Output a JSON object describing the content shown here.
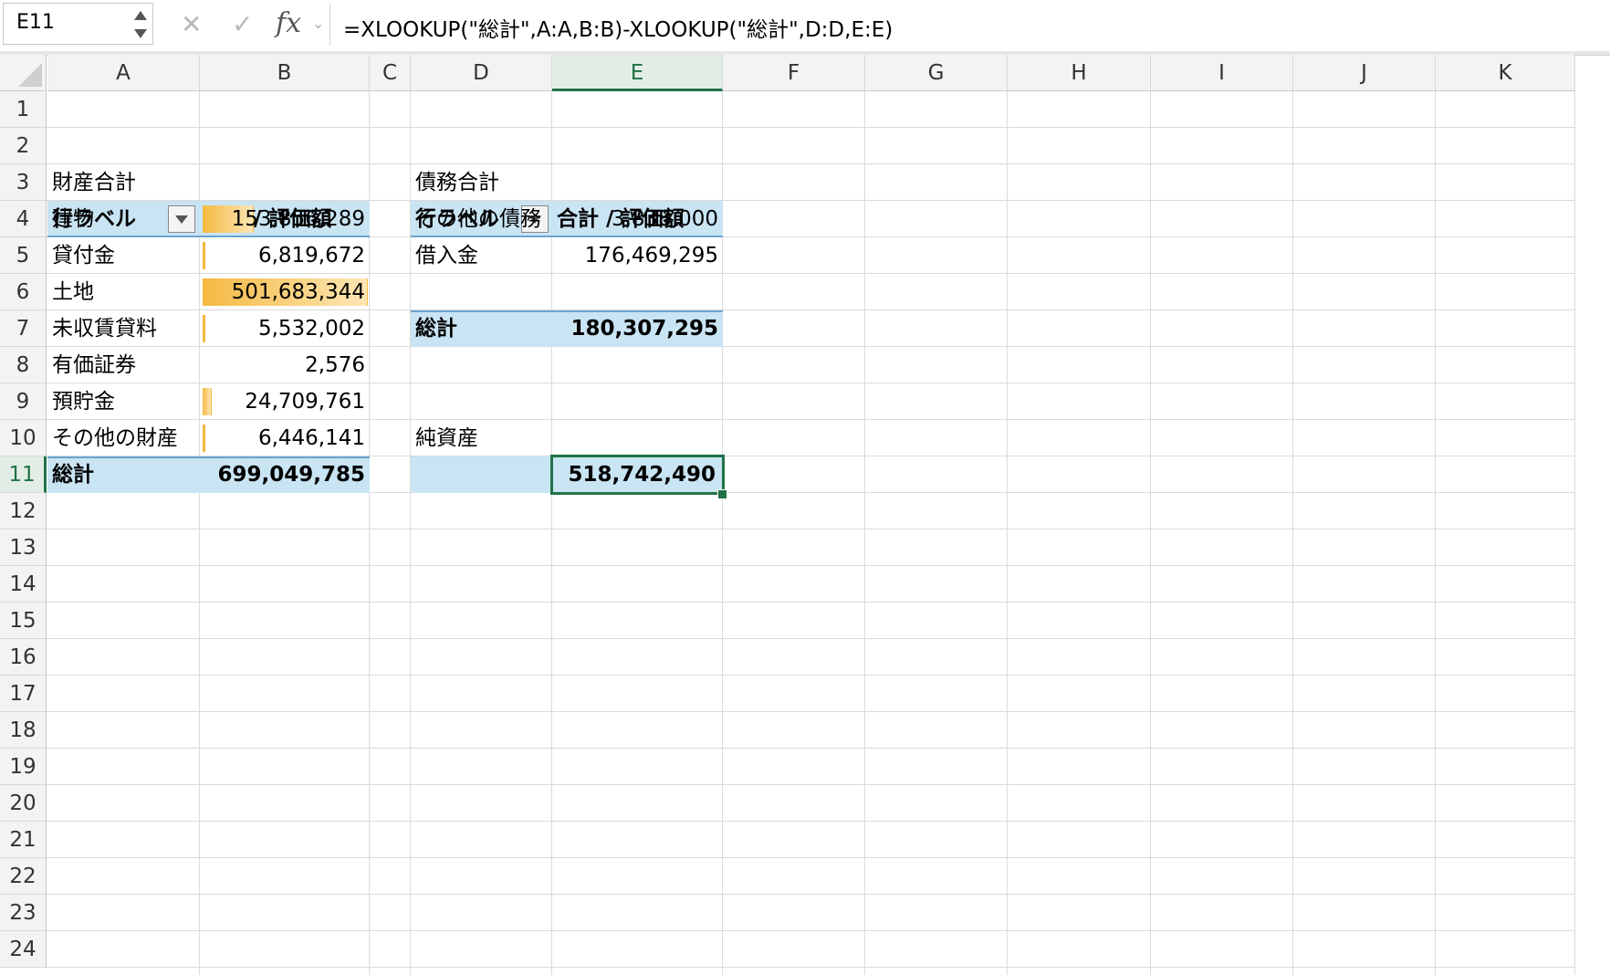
{
  "formula_bar": {
    "name_box": "E11",
    "formula": "=XLOOKUP(\"総計\",A:A,B:B)-XLOOKUP(\"総計\",D:D,E:E)",
    "cancel_icon": "✕",
    "enter_icon": "✓",
    "fx_label": "fx"
  },
  "columns": [
    "A",
    "B",
    "C",
    "D",
    "E",
    "F",
    "G",
    "H",
    "I",
    "J",
    "K"
  ],
  "selected_cell": "E11",
  "rows": [
    "1",
    "2",
    "3",
    "4",
    "5",
    "6",
    "7",
    "8",
    "9",
    "10",
    "11",
    "12",
    "13",
    "14",
    "15",
    "16",
    "17",
    "18",
    "19",
    "20",
    "21",
    "22",
    "23",
    "24"
  ],
  "assets_pivot": {
    "title": "財産合計",
    "header_label": "行ラベル",
    "header_value": "合計 / 評価額",
    "items": [
      {
        "label": "建物",
        "value": "153,856,289",
        "bar_fraction": 0.307
      },
      {
        "label": "貸付金",
        "value": "6,819,672",
        "bar_fraction": 0.014
      },
      {
        "label": "土地",
        "value": "501,683,344",
        "bar_fraction": 1.0
      },
      {
        "label": "未収賃貸料",
        "value": "5,532,002",
        "bar_fraction": 0.011
      },
      {
        "label": "有価証券",
        "value": "2,576",
        "bar_fraction": 0.0
      },
      {
        "label": "預貯金",
        "value": "24,709,761",
        "bar_fraction": 0.049
      },
      {
        "label": "その他の財産",
        "value": "6,446,141",
        "bar_fraction": 0.013
      }
    ],
    "total_label": "総計",
    "total_value": "699,049,785"
  },
  "liabilities_pivot": {
    "title": "債務合計",
    "header_label": "行ラベル",
    "header_value": "合計 / 評価額",
    "items": [
      {
        "label": "その他の債務",
        "value": "3,838,000"
      },
      {
        "label": "借入金",
        "value": "176,469,295"
      }
    ],
    "total_label": "総計",
    "total_value": "180,307,295"
  },
  "net_assets": {
    "label": "純資産",
    "value": "518,742,490"
  },
  "colors": {
    "accent": "#217346",
    "pivot_header": "#c9e4f3",
    "databar": "#f4b942"
  }
}
